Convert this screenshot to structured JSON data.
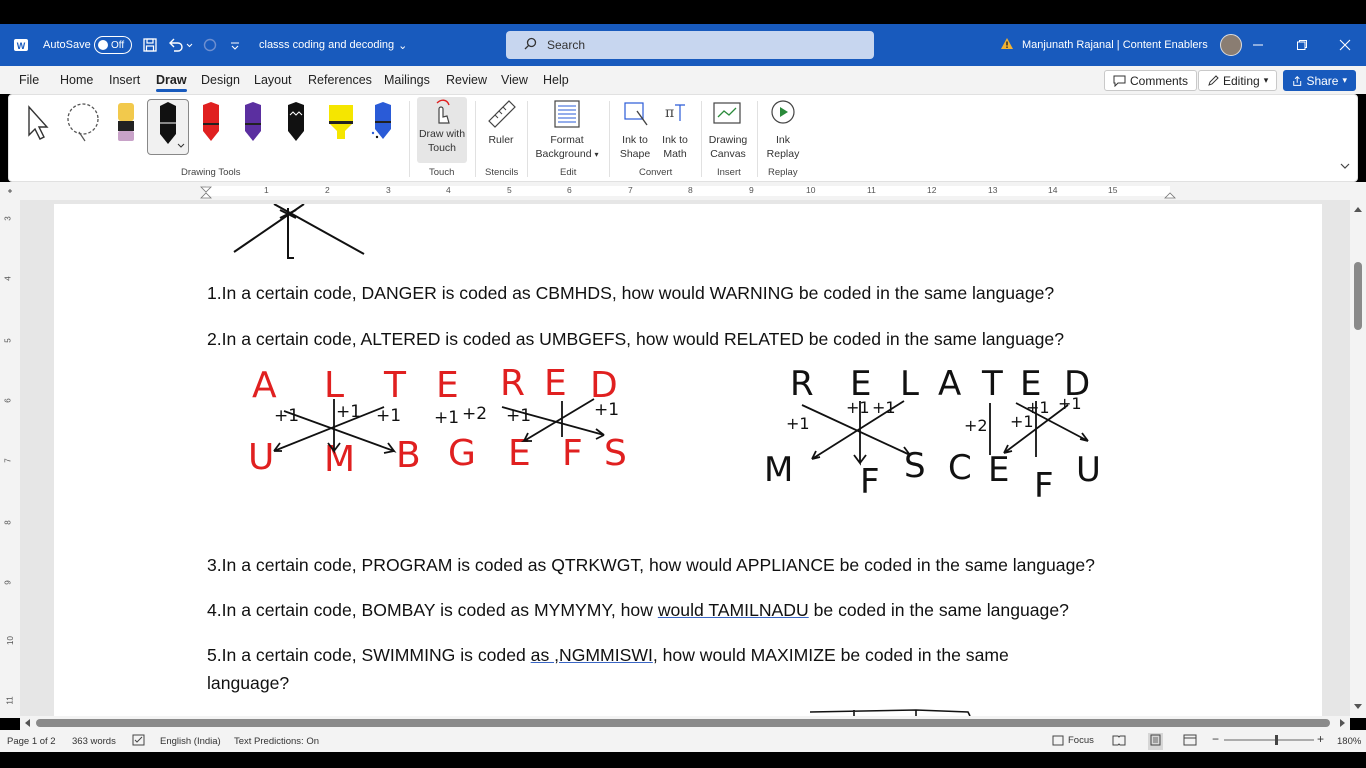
{
  "titlebar": {
    "autosave_label": "AutoSave",
    "autosave_state": "Off",
    "doc_name": "classs coding and decoding",
    "search_placeholder": "Search",
    "user": "Manjunath Rajanal | Content Enablers"
  },
  "menu": {
    "tabs": [
      "File",
      "Home",
      "Insert",
      "Draw",
      "Design",
      "Layout",
      "References",
      "Mailings",
      "Review",
      "View",
      "Help"
    ],
    "active": "Draw",
    "comments": "Comments",
    "editing": "Editing",
    "share": "Share"
  },
  "ribbon": {
    "groups": {
      "drawing_tools": "Drawing Tools",
      "touch": "Touch",
      "stencils": "Stencils",
      "edit": "Edit",
      "convert": "Convert",
      "insert": "Insert",
      "replay": "Replay"
    },
    "draw_with_touch": [
      "Draw with",
      "Touch"
    ],
    "ruler": "Ruler",
    "format_background": [
      "Format",
      "Background"
    ],
    "ink_to_shape": [
      "Ink to",
      "Shape"
    ],
    "ink_to_math": [
      "Ink to",
      "Math"
    ],
    "drawing_canvas": [
      "Drawing",
      "Canvas"
    ],
    "ink_replay": [
      "Ink",
      "Replay"
    ],
    "pen_colors": [
      "#f2c94c",
      "#111111",
      "#e02020",
      "#5b2fa0",
      "#111111",
      "#f5e600",
      "#2a5bd7"
    ]
  },
  "ruler": {
    "h_numbers": [
      "1",
      "2",
      "3",
      "4",
      "5",
      "6",
      "7",
      "8",
      "9",
      "10",
      "11",
      "12",
      "13",
      "14",
      "15"
    ],
    "v_numbers": [
      "3",
      "4",
      "5",
      "6",
      "7",
      "8",
      "9",
      "10",
      "11"
    ]
  },
  "document": {
    "q1": "1.In a certain code, DANGER is coded as CBMHDS, how would WARNING be coded in the same language?",
    "q2": "2.In a certain code, ALTERED is coded as UMBGEFS, how would RELATED be coded in the same language?",
    "q3": "3.In a certain code, PROGRAM is coded as QTRKWGT, how would APPLIANCE be coded in the same language?",
    "q4_pre": "4.In a certain code, BOMBAY is coded as MYMYMY, how ",
    "q4_ul": "would  TAMILNADU",
    "q4_post": " be coded in the same language?",
    "q5_pre": "5.In a certain code, SWIMMING is coded ",
    "q5_ul": "as ,NGMMISWI",
    "q5_post": ", how would MAXIMIZE be coded in the same",
    "q5_line2": "language?",
    "ink_red_top": [
      "A",
      "L",
      "T",
      "E",
      "R",
      "E",
      "D"
    ],
    "ink_red_bottom": [
      "U",
      "M",
      "B",
      "G",
      "E",
      "F",
      "S"
    ],
    "ink_red_marks": [
      "+1",
      "+1",
      "+1",
      "+1",
      "+2",
      "+1",
      "+1"
    ],
    "ink_black_top": [
      "R",
      "E",
      "L",
      "A",
      "T",
      "E",
      "D"
    ],
    "ink_black_bottom": [
      "M",
      "F",
      "S",
      "C",
      "E",
      "F",
      "U"
    ],
    "ink_black_marks": [
      "+1",
      "+1",
      "+1",
      "+2",
      "+1",
      "+1",
      "+1"
    ]
  },
  "status": {
    "page": "Page 1 of 2",
    "words": "363 words",
    "language": "English (India)",
    "predictions": "Text Predictions: On",
    "focus": "Focus",
    "zoom": "180%"
  }
}
